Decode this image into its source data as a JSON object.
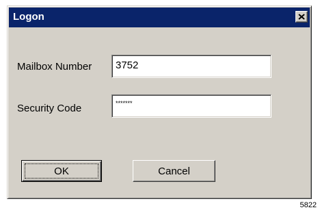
{
  "window": {
    "title": "Logon"
  },
  "form": {
    "mailbox_label": "Mailbox Number",
    "mailbox_value": "3752",
    "security_label": "Security Code",
    "security_value": "*******"
  },
  "buttons": {
    "ok_label": "OK",
    "cancel_label": "Cancel"
  },
  "figure_number": "5822",
  "icons": {
    "close": "close-icon"
  },
  "colors": {
    "titlebar": "#0a246a",
    "dialog": "#d4d0c8"
  }
}
